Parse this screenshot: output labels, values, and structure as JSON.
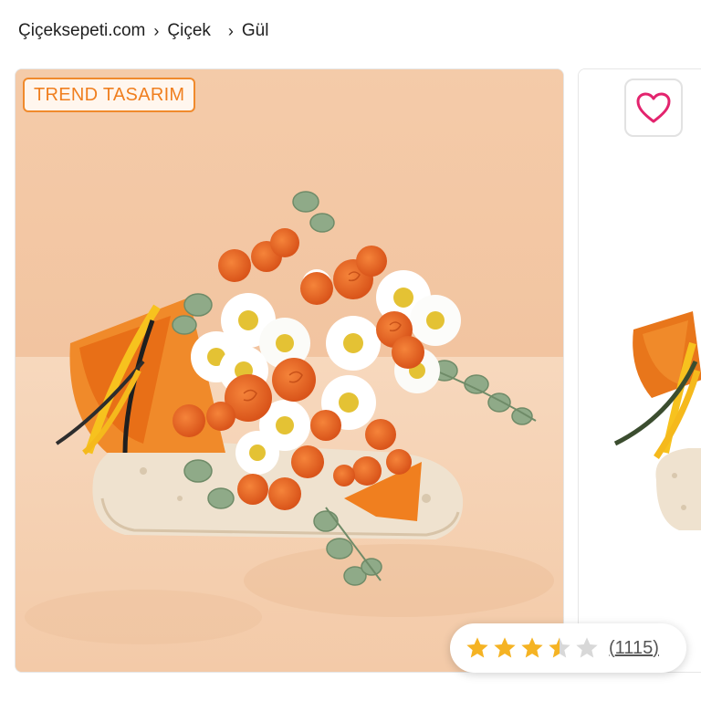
{
  "breadcrumb": {
    "items": [
      "Çiçeksepeti.com",
      "Çiçek",
      "Gül"
    ]
  },
  "product": {
    "badge": "TREND TASARIM",
    "image_alt": "Orange spray roses and white daisy bouquet wrapped in orange paper on a travertine stone",
    "rating": {
      "stars_filled": 3.5,
      "stars_total": 5,
      "count_paren_open": "(",
      "count": "1115",
      "count_paren_close": ")"
    }
  },
  "icons": {
    "breadcrumb_separator": "chevron-right-icon",
    "favorite": "heart-icon",
    "rating_star": "star-icon"
  },
  "colors": {
    "badge_accent": "#f07f1f",
    "heart": "#e3246e",
    "star_filled": "#f5b323",
    "star_empty": "#d8d8d8",
    "photo_background": "#f3c9a6"
  }
}
